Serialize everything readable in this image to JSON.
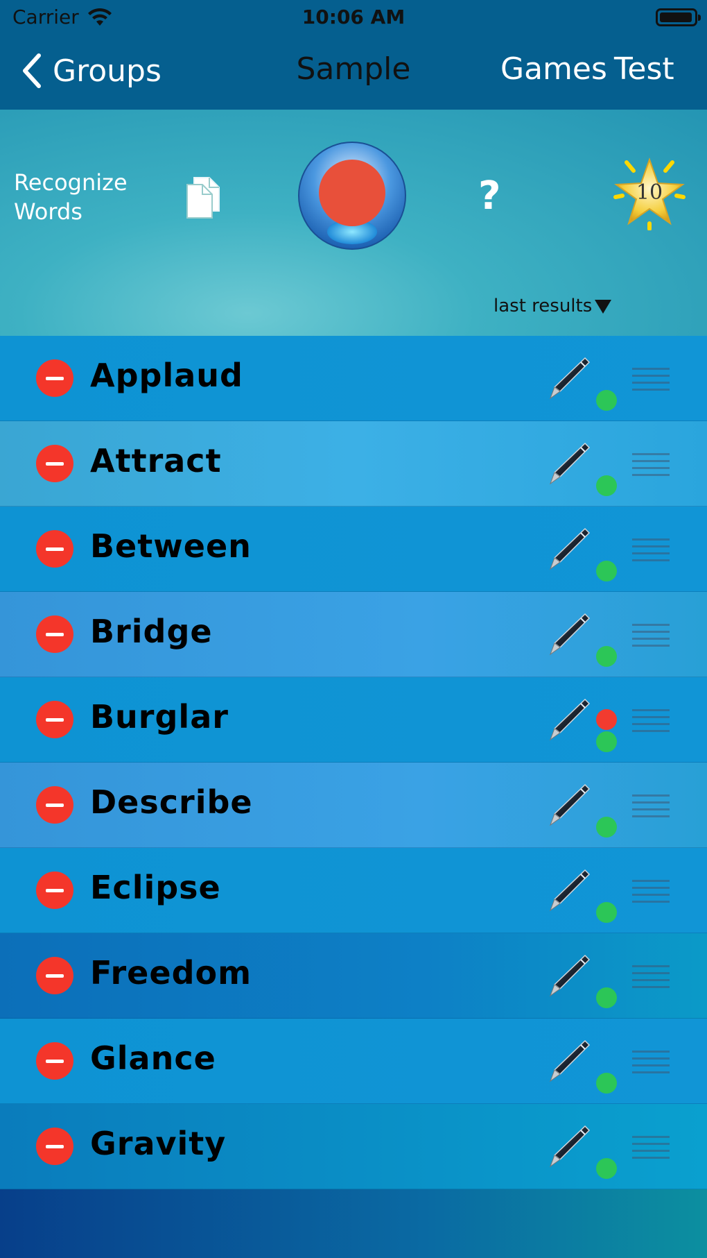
{
  "status_bar": {
    "carrier": "Carrier",
    "time": "10:06 AM"
  },
  "nav": {
    "back_label": "Groups",
    "title": "Sample",
    "games_label": "Games",
    "test_label": "Test"
  },
  "panel": {
    "recognize_line1": "Recognize",
    "recognize_line2": "Words",
    "help_label": "?",
    "star_count": "10",
    "last_results_label": "last results"
  },
  "words": [
    {
      "label": "Applaud",
      "dots": [
        "green"
      ]
    },
    {
      "label": "Attract",
      "dots": [
        "green"
      ]
    },
    {
      "label": "Between",
      "dots": [
        "green"
      ]
    },
    {
      "label": "Bridge",
      "dots": [
        "green"
      ]
    },
    {
      "label": "Burglar",
      "dots": [
        "red",
        "green"
      ]
    },
    {
      "label": "Describe",
      "dots": [
        "green"
      ]
    },
    {
      "label": "Eclipse",
      "dots": [
        "green"
      ]
    },
    {
      "label": "Freedom",
      "dots": [
        "green"
      ]
    },
    {
      "label": "Glance",
      "dots": [
        "green"
      ]
    },
    {
      "label": "Gravity",
      "dots": [
        "green"
      ]
    }
  ],
  "colors": {
    "delete": "#f4362a",
    "result_correct": "#2cc657",
    "result_wrong": "#f23b2f",
    "nav_bg": "#055f8f"
  }
}
